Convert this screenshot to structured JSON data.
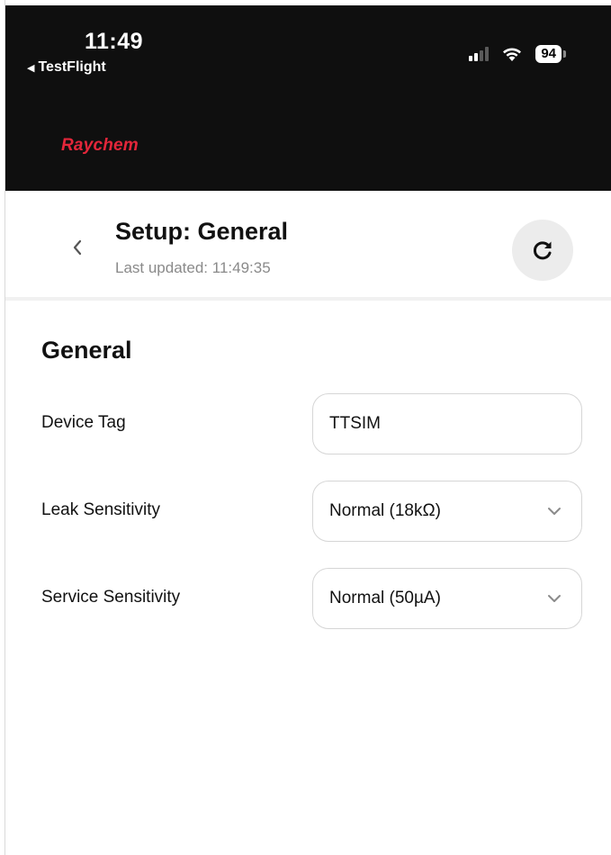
{
  "status_bar": {
    "time": "11:49",
    "back_app": "TestFlight",
    "battery": "94",
    "signal_icon": "signal-icon",
    "wifi_icon": "wifi-icon"
  },
  "brand": {
    "logo_text": "Raychem",
    "color": "#e3263a"
  },
  "header": {
    "title": "Setup: General",
    "last_updated": "Last updated: 11:49:35",
    "back_icon": "chevron-left-icon",
    "refresh_icon": "refresh-icon"
  },
  "section": {
    "title": "General",
    "fields": [
      {
        "label": "Device Tag",
        "type": "text",
        "value": "TTSIM"
      },
      {
        "label": "Leak Sensitivity",
        "type": "select",
        "value": "Normal (18kΩ)"
      },
      {
        "label": "Service Sensitivity",
        "type": "select",
        "value": "Normal (50µA)"
      }
    ]
  }
}
